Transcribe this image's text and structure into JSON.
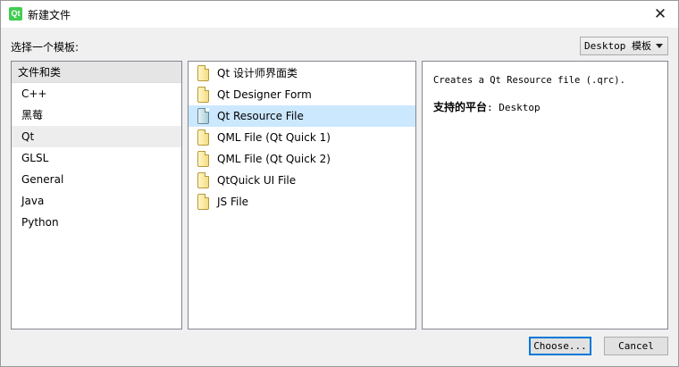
{
  "window": {
    "title": "新建文件",
    "app_icon_text": "Qt",
    "close_glyph": "✕"
  },
  "choose_template_label": "选择一个模板:",
  "platform_filter": {
    "selected": "Desktop 模板"
  },
  "categories": {
    "header": "文件和类",
    "items": [
      "C++",
      "黑莓",
      "Qt",
      "GLSL",
      "General",
      "Java",
      "Python"
    ],
    "active_index": 2
  },
  "templates": {
    "items": [
      {
        "label": "Qt 设计师界面类",
        "icon": "file-icon"
      },
      {
        "label": "Qt Designer Form",
        "icon": "file-icon"
      },
      {
        "label": "Qt Resource File",
        "icon": "resource-file-icon"
      },
      {
        "label": "QML File (Qt Quick 1)",
        "icon": "file-icon"
      },
      {
        "label": "QML File (Qt Quick 2)",
        "icon": "file-icon"
      },
      {
        "label": "QtQuick UI File",
        "icon": "file-icon"
      },
      {
        "label": "JS File",
        "icon": "file-icon"
      }
    ],
    "selected_index": 2
  },
  "details": {
    "description": "Creates a Qt Resource file (.qrc).",
    "platforms_label": "支持的平台",
    "platforms_value": ": Desktop"
  },
  "buttons": {
    "choose": "Choose...",
    "cancel": "Cancel"
  },
  "colors": {
    "selection": "#cce8ff",
    "default_button_border": "#0078d7",
    "qt_green": "#41cd52"
  }
}
